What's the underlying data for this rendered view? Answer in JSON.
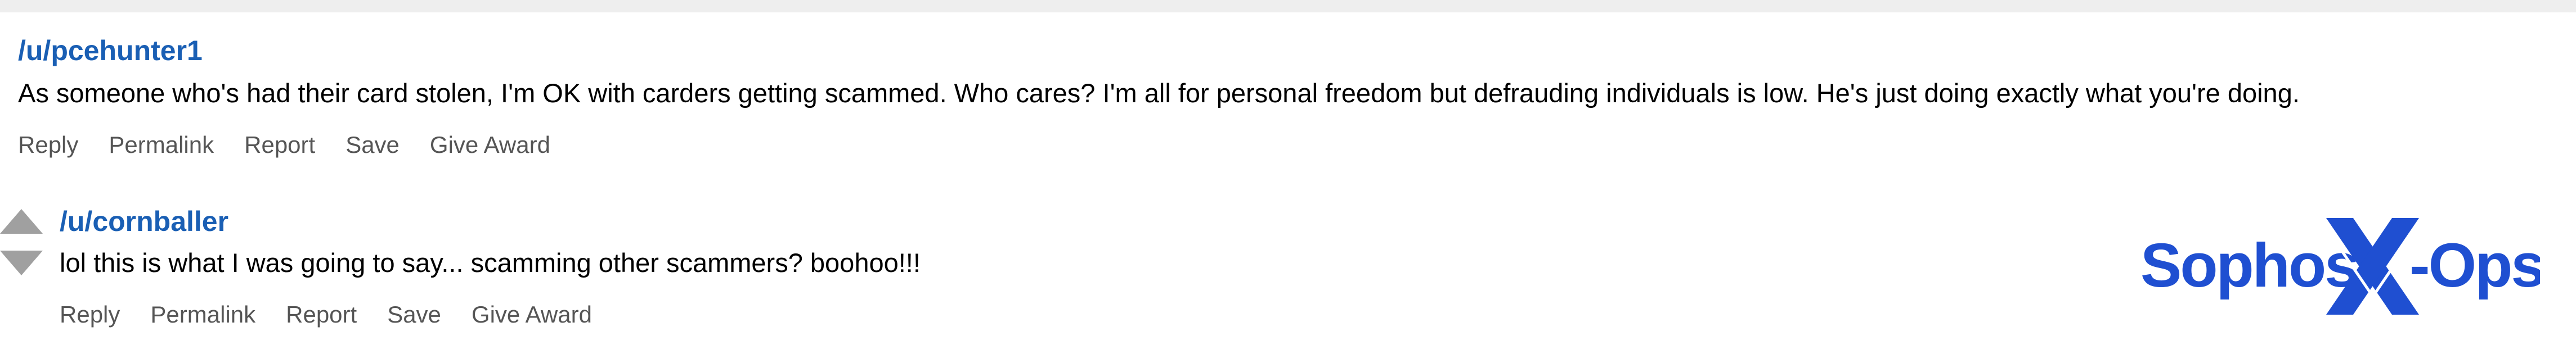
{
  "comments": [
    {
      "username": "/u/pcehunter1",
      "text": "As someone who's had their card stolen, I'm OK with carders getting scammed. Who cares? I'm all for personal freedom but defrauding individuals is low. He's just doing exactly what you're doing.",
      "actions": [
        "Reply",
        "Permalink",
        "Report",
        "Save",
        "Give Award"
      ]
    },
    {
      "username": "/u/cornballer",
      "text": "lol this is what I was going to say... scamming other scammers? boohoo!!!",
      "actions": [
        "Reply",
        "Permalink",
        "Report",
        "Save",
        "Give Award"
      ]
    }
  ],
  "logo": {
    "text_left": "Sophos",
    "text_right": "-Ops",
    "color": "#1f4fd1"
  },
  "colors": {
    "username": "#1a5fb4",
    "action": "#555555",
    "vote_arrow": "#a0a0a0"
  },
  "icons": [
    "upvote-arrow-icon",
    "downvote-arrow-icon",
    "sophos-x-ops-logo"
  ]
}
